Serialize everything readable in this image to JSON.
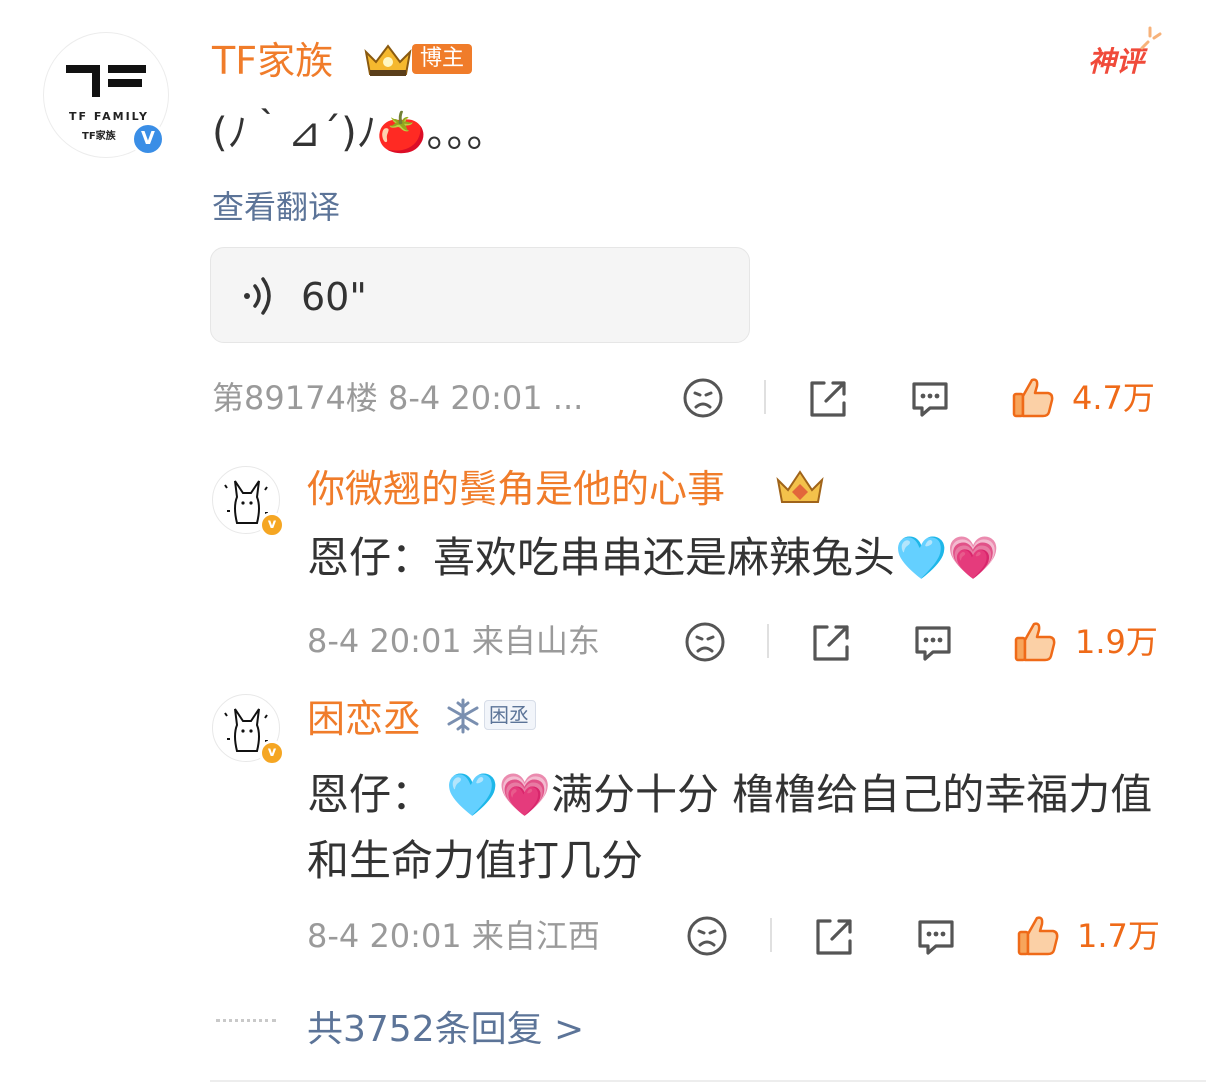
{
  "main_comment": {
    "avatar_text": "TF FAMILY",
    "avatar_subtext": "TF家族",
    "verified_badge": "V",
    "username": "TF家族",
    "role_badge": "博主",
    "text": "(ﾉ｀⊿´)ﾉ🍅。。。",
    "translate_label": "查看翻译",
    "voice_duration": "60\"",
    "floor_time": "第89174楼 8-4 20:01 ...",
    "likes": "4.7万",
    "god_comment_label": "神评"
  },
  "replies": [
    {
      "username": "你微翘的鬓角是他的心事",
      "text": "恩仔：喜欢吃串串还是麻辣兔头🩵💗",
      "meta": "8-4 20:01 来自山东",
      "likes": "1.9万"
    },
    {
      "username": "困恋丞",
      "fan_tag": "困丞",
      "text": "恩仔： 🩵💗满分十分 橹橹给自己的幸福力值和生命力值打几分",
      "meta": "8-4 20:01 来自江西",
      "likes": "1.7万"
    }
  ],
  "reply_total": "共3752条回复 >",
  "colors": {
    "accent_orange": "#f07c2a",
    "like_orange": "#ef6a18",
    "link_blue": "#5c7498",
    "meta_gray": "#9a9a9a"
  },
  "icons": [
    "sad-face-icon",
    "share-icon",
    "comment-icon",
    "thumbs-up-icon",
    "voice-wave-icon",
    "crown-icon",
    "snowflake-icon"
  ]
}
